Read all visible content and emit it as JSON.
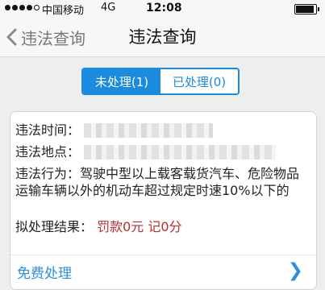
{
  "status_bar": {
    "carrier": "中国移动",
    "network": "4G",
    "time": "12:08"
  },
  "nav": {
    "back_label": "违法查询",
    "title": "违法查询"
  },
  "tabs": [
    {
      "label": "未处理(1)",
      "active": true
    },
    {
      "label": "已处理(0)",
      "active": false
    }
  ],
  "violation": {
    "time_label": "违法时间：",
    "location_label": "违法地点：",
    "behavior_label": "违法行为：",
    "behavior_text": "驾驶中型以上载客载货汽车、危险物品运输车辆以外的机动车超过规定时速10%以下的",
    "result_label": "拟处理结果：",
    "fine_text": "罚款0元 记0分"
  },
  "footer": {
    "link_text": "免费处理",
    "arrow": "❯"
  },
  "colors": {
    "accent": "#1b8be0",
    "fine": "#b72f2f",
    "link": "#2d8fe4"
  },
  "icons": {
    "back": "chevron-left-icon",
    "arrow": "chevron-right-icon"
  }
}
